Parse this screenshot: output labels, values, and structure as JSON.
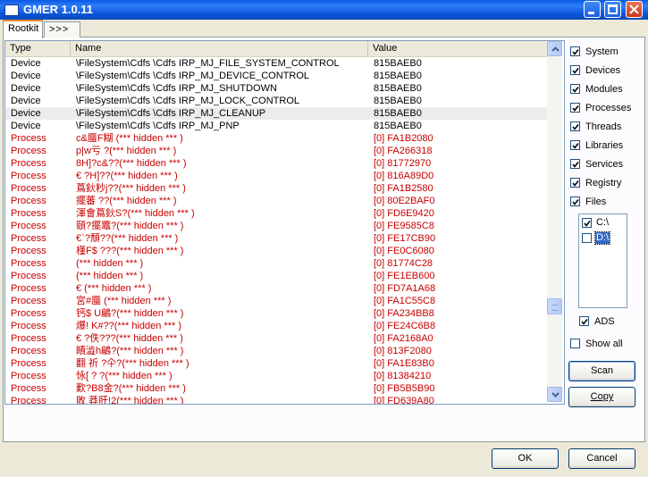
{
  "window": {
    "title": "GMER 1.0.11"
  },
  "tabs": [
    {
      "label": "Rootkit"
    },
    {
      "label": ">>>"
    }
  ],
  "columns": {
    "type": "Type",
    "name": "Name",
    "value": "Value"
  },
  "rows": [
    {
      "type": "Device",
      "name": "\\FileSystem\\Cdfs \\Cdfs IRP_MJ_FILE_SYSTEM_CONTROL",
      "value": "815BAEB0"
    },
    {
      "type": "Device",
      "name": "\\FileSystem\\Cdfs \\Cdfs IRP_MJ_DEVICE_CONTROL",
      "value": "815BAEB0"
    },
    {
      "type": "Device",
      "name": "\\FileSystem\\Cdfs \\Cdfs IRP_MJ_SHUTDOWN",
      "value": "815BAEB0"
    },
    {
      "type": "Device",
      "name": "\\FileSystem\\Cdfs \\Cdfs IRP_MJ_LOCK_CONTROL",
      "value": "815BAEB0"
    },
    {
      "type": "Device",
      "name": "\\FileSystem\\Cdfs \\Cdfs IRP_MJ_CLEANUP",
      "value": "815BAEB0"
    },
    {
      "type": "Device",
      "name": "\\FileSystem\\Cdfs \\Cdfs IRP_MJ_PNP",
      "value": "815BAEB0"
    },
    {
      "type": "Process",
      "name": "c&蜃F糊 (*** hidden *** )",
      "value": "[0] FA1B2080"
    },
    {
      "type": "Process",
      "name": "p|w亏 ?(*** hidden *** )",
      "value": "[0] FA266318"
    },
    {
      "type": "Process",
      "name": "8H]?c&??(*** hidden *** )",
      "value": "[0] 81772970"
    },
    {
      "type": "Process",
      "name": "€ ?H]??(*** hidden *** )",
      "value": "[0] 816A89D0"
    },
    {
      "type": "Process",
      "name": "蔦鈥粆j??(*** hidden *** )",
      "value": "[0] FA1B2580"
    },
    {
      "type": "Process",
      "name": "擺蕃 ??(*** hidden *** )",
      "value": "[0] 80E2BAF0"
    },
    {
      "type": "Process",
      "name": "渾會蔦鈥S?(*** hidden *** )",
      "value": "[0] FD6E9420"
    },
    {
      "type": "Process",
      "name": "頤?擺竈?(*** hidden *** )",
      "value": "[0] FE9585C8"
    },
    {
      "type": "Process",
      "name": "€`?頽??(*** hidden *** )",
      "value": "[0] FE17CB90"
    },
    {
      "type": "Process",
      "name": "槿F$ ???(*** hidden *** )",
      "value": "[0] FE0C6080"
    },
    {
      "type": "Process",
      "name": "(*** hidden *** )",
      "value": "[0] 81774C28"
    },
    {
      "type": "Process",
      "name": "(*** hidden *** )",
      "value": "[0] FE1EB600"
    },
    {
      "type": "Process",
      "name": "€ (*** hidden *** )",
      "value": "[0] FD7A1A68"
    },
    {
      "type": "Process",
      "name": "宮#蜃 (*** hidden *** )",
      "value": "[0] FA1C55C8"
    },
    {
      "type": "Process",
      "name": "钙$ U鶣?(*** hidden *** )",
      "value": "[0] FA234BB8"
    },
    {
      "type": "Process",
      "name": "爆! K#??(*** hidden *** )",
      "value": "[0] FE24C6B8"
    },
    {
      "type": "Process",
      "name": "€ ?佚???(*** hidden *** )",
      "value": "[0] FA2168A0"
    },
    {
      "type": "Process",
      "name": "瞔澁h鶣?(*** hidden *** )",
      "value": "[0] 813F2080"
    },
    {
      "type": "Process",
      "name": "翻 祈 ?仐?(*** hidden *** )",
      "value": "[0] FA1E83B0"
    },
    {
      "type": "Process",
      "name": "怺[ ? ?(*** hidden *** )",
      "value": "[0] 81384210"
    },
    {
      "type": "Process",
      "name": "歎?B8金?(*** hidden *** )",
      "value": "[0] FB5B5B90"
    },
    {
      "type": "Process",
      "name": "敗 莽肝!2(*** hidden *** )",
      "value": "[0] FD639A80"
    }
  ],
  "options": [
    {
      "label": "System",
      "checked": true
    },
    {
      "label": "Devices",
      "checked": true
    },
    {
      "label": "Modules",
      "checked": true
    },
    {
      "label": "Processes",
      "checked": true
    },
    {
      "label": "Threads",
      "checked": true
    },
    {
      "label": "Libraries",
      "checked": true
    },
    {
      "label": "Services",
      "checked": true
    },
    {
      "label": "Registry",
      "checked": true
    },
    {
      "label": "Files",
      "checked": true
    }
  ],
  "drives": [
    {
      "label": "C:\\",
      "checked": true,
      "selected": false
    },
    {
      "label": "D:\\",
      "checked": false,
      "selected": true
    }
  ],
  "ads": {
    "label": "ADS",
    "checked": true
  },
  "show_all": {
    "label": "Show all",
    "checked": false
  },
  "buttons": {
    "scan": "Scan",
    "copy": "Copy",
    "ok": "OK",
    "cancel": "Cancel"
  }
}
